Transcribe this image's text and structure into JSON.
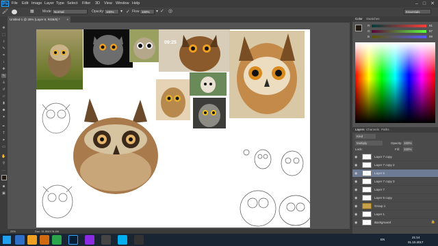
{
  "menubar": {
    "logo": "Ps",
    "items": [
      "File",
      "Edit",
      "Image",
      "Layer",
      "Type",
      "Select",
      "Filter",
      "3D",
      "View",
      "Window",
      "Help"
    ],
    "window_controls": [
      "–",
      "□",
      "✕"
    ]
  },
  "options_bar": {
    "mode_label": "Mode:",
    "mode_value": "Normal",
    "opacity_label": "Opacity:",
    "opacity_value": "100%",
    "flow_label": "Flow:",
    "flow_value": "100%",
    "workspace": "Essentials"
  },
  "document_tab": {
    "title": "Untitled-1 @ 25% (Layer 6, RGB/8) *",
    "close": "×"
  },
  "canvas": {
    "photo_timestamp": "09:25",
    "background_color": "#ffffff"
  },
  "statusbar": {
    "zoom": "25%",
    "doc_info": "Doc: 31.9M/178.4M"
  },
  "color_panel": {
    "tabs": [
      "Color",
      "Swatches"
    ],
    "sliders": [
      {
        "label": "R",
        "value": "91"
      },
      {
        "label": "G",
        "value": "87"
      },
      {
        "label": "B",
        "value": "59"
      }
    ],
    "foreground": "#231b12",
    "background": "#ffffff"
  },
  "layers_panel": {
    "tabs": [
      "Layers",
      "Channels",
      "Paths"
    ],
    "kind_label": "Kind",
    "blend_mode": "Multiply",
    "opacity_label": "Opacity:",
    "opacity_value": "100%",
    "lock_label": "Lock:",
    "fill_label": "Fill:",
    "fill_value": "100%",
    "layers": [
      {
        "name": "Layer 7 copy"
      },
      {
        "name": "Layer 7 copy 2"
      },
      {
        "name": "Layer 6",
        "selected": true
      },
      {
        "name": "Layer 7 copy 3"
      },
      {
        "name": "Layer 7"
      },
      {
        "name": "Layer 5 copy"
      },
      {
        "name": "Group 1"
      },
      {
        "name": "Layer 1"
      },
      {
        "name": "Background"
      }
    ]
  },
  "taskbar": {
    "lang": "EN",
    "time": "21:14",
    "date": "01.10.2017"
  }
}
